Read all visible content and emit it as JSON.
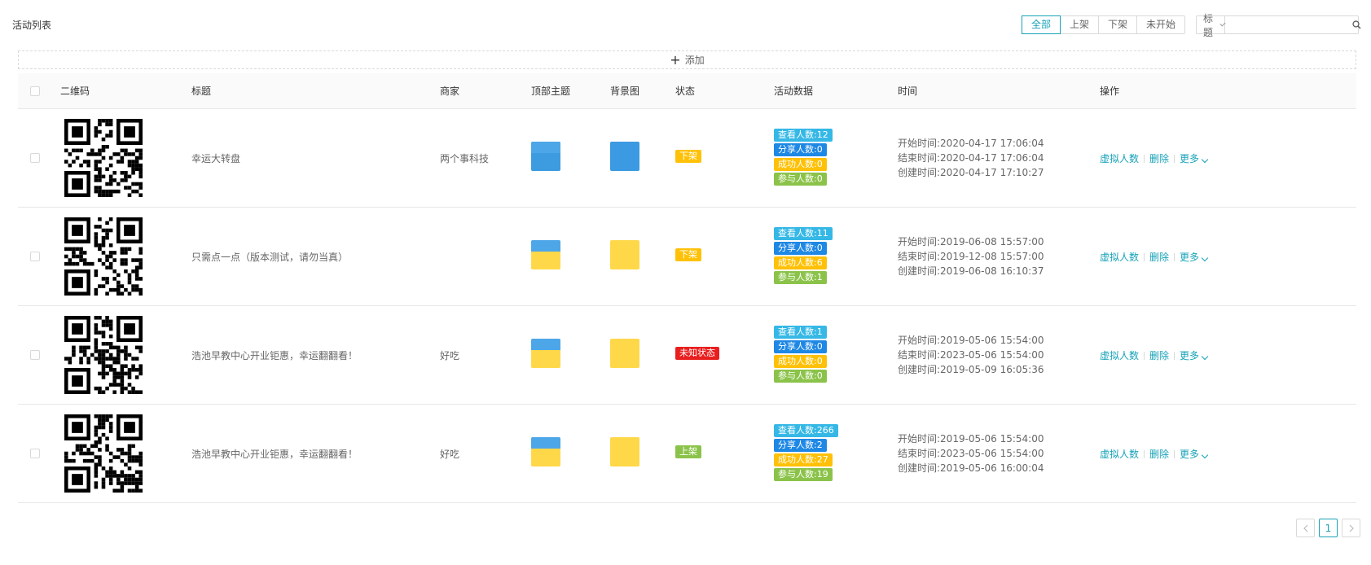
{
  "page": {
    "title": "活动列表"
  },
  "filters": [
    "全部",
    "上架",
    "下架",
    "未开始"
  ],
  "search": {
    "field": "标题",
    "placeholder": ""
  },
  "add_label": "添加",
  "columns": [
    "二维码",
    "标题",
    "商家",
    "顶部主题",
    "背景图",
    "状态",
    "活动数据",
    "时间",
    "操作"
  ],
  "rows": [
    {
      "title": "幸运大转盘",
      "merchant": "两个事科技",
      "status": "下架",
      "stats": [
        "查看人数:12",
        "分享人数:0",
        "成功人数:0",
        "参与人数:0"
      ],
      "times": [
        "开始时间:2020-04-17 17:06:04",
        "结束时间:2020-04-17 17:06:04",
        "创建时间:2020-04-17 17:10:27"
      ],
      "ops": [
        "虚拟人数",
        "删除",
        "更多"
      ]
    },
    {
      "title": "只需点一点（版本测试，请勿当真）",
      "merchant": "",
      "status": "下架",
      "stats": [
        "查看人数:11",
        "分享人数:0",
        "成功人数:6",
        "参与人数:1"
      ],
      "times": [
        "开始时间:2019-06-08 15:57:00",
        "结束时间:2019-12-08 15:57:00",
        "创建时间:2019-06-08 16:10:37"
      ],
      "ops": [
        "虚拟人数",
        "删除",
        "更多"
      ]
    },
    {
      "title": "浩池早教中心开业钜惠，幸运翻翻看！",
      "merchant": "好吃",
      "status": "未知状态",
      "stats": [
        "查看人数:1",
        "分享人数:0",
        "成功人数:0",
        "参与人数:0"
      ],
      "times": [
        "开始时间:2019-05-06 15:54:00",
        "结束时间:2023-05-06 15:54:00",
        "创建时间:2019-05-09 16:05:36"
      ],
      "ops": [
        "虚拟人数",
        "删除",
        "更多"
      ]
    },
    {
      "title": "浩池早教中心开业钜惠，幸运翻翻看！",
      "merchant": "好吃",
      "status": "上架",
      "stats": [
        "查看人数:266",
        "分享人数:2",
        "成功人数:27",
        "参与人数:19"
      ],
      "times": [
        "开始时间:2019-05-06 15:54:00",
        "结束时间:2023-05-06 15:54:00",
        "创建时间:2019-05-06 16:00:04"
      ],
      "ops": [
        "虚拟人数",
        "删除",
        "更多"
      ]
    }
  ],
  "pagination": {
    "current": "1"
  },
  "colors": {
    "accent": "#17a2b8",
    "status_off": "#ffc107",
    "status_on": "#8bc34a",
    "status_unknown": "#e91e1e",
    "stat_view": "#35b8e6",
    "stat_share": "#1e88e5",
    "stat_success": "#ffc107",
    "stat_join": "#8bc34a"
  }
}
